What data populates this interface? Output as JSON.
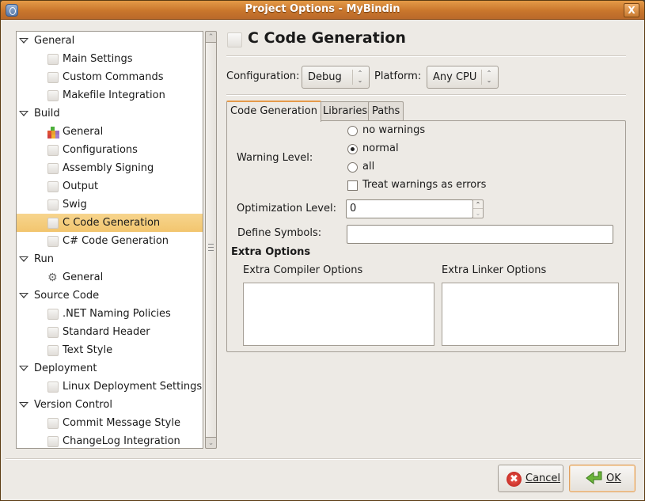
{
  "window": {
    "title": "Project Options - MyBindin",
    "close_label": "X"
  },
  "sidebar": {
    "categories": [
      {
        "label": "General",
        "expanded": true,
        "items": [
          {
            "label": "Main Settings",
            "icon": "blank-page-icon"
          },
          {
            "label": "Custom Commands",
            "icon": "blank-page-icon"
          },
          {
            "label": "Makefile Integration",
            "icon": "blank-page-icon"
          }
        ]
      },
      {
        "label": "Build",
        "expanded": true,
        "items": [
          {
            "label": "General",
            "icon": "build-blocks-icon"
          },
          {
            "label": "Configurations",
            "icon": "blank-page-icon"
          },
          {
            "label": "Assembly Signing",
            "icon": "blank-page-icon"
          },
          {
            "label": "Output",
            "icon": "blank-page-icon"
          },
          {
            "label": "Swig",
            "icon": "blank-page-icon"
          },
          {
            "label": "C Code Generation",
            "icon": "blank-page-icon",
            "selected": true
          },
          {
            "label": "C# Code Generation",
            "icon": "blank-page-icon"
          }
        ]
      },
      {
        "label": "Run",
        "expanded": true,
        "items": [
          {
            "label": "General",
            "icon": "gears-icon"
          }
        ]
      },
      {
        "label": "Source Code",
        "expanded": true,
        "items": [
          {
            "label": ".NET Naming Policies",
            "icon": "blank-page-icon"
          },
          {
            "label": "Standard Header",
            "icon": "blank-page-icon"
          },
          {
            "label": "Text Style",
            "icon": "blank-page-icon"
          }
        ]
      },
      {
        "label": "Deployment",
        "expanded": true,
        "items": [
          {
            "label": "Linux Deployment Settings",
            "icon": "blank-page-icon"
          }
        ]
      },
      {
        "label": "Version Control",
        "expanded": true,
        "items": [
          {
            "label": "Commit Message Style",
            "icon": "blank-page-icon"
          },
          {
            "label": "ChangeLog Integration",
            "icon": "blank-page-icon"
          }
        ]
      }
    ]
  },
  "panel": {
    "title": "C Code Generation",
    "configuration_label": "Configuration:",
    "configuration_value": "Debug",
    "platform_label": "Platform:",
    "platform_value": "Any CPU",
    "tabs": [
      {
        "label": "Code Generation",
        "active": true
      },
      {
        "label": "Libraries",
        "active": false
      },
      {
        "label": "Paths",
        "active": false
      }
    ],
    "warning_level_label": "Warning Level:",
    "warning_options": [
      {
        "label": "no warnings",
        "checked": false
      },
      {
        "label": "normal",
        "checked": true
      },
      {
        "label": "all",
        "checked": false
      }
    ],
    "treat_warnings_label": "Treat warnings as errors",
    "treat_warnings_checked": false,
    "optimization_label": "Optimization Level:",
    "optimization_value": "0",
    "define_symbols_label": "Define Symbols:",
    "define_symbols_value": "",
    "extra_options_heading": "Extra Options",
    "extra_compiler_label": "Extra Compiler Options",
    "extra_compiler_value": "",
    "extra_linker_label": "Extra Linker Options",
    "extra_linker_value": ""
  },
  "buttons": {
    "cancel_mnemonic": "C",
    "cancel_rest": "ancel",
    "ok_mnemonic": "O",
    "ok_rest": "K"
  },
  "colors": {
    "titlebar": "#c9762c",
    "selection": "#f2c56e",
    "tab_accent": "#e59a4a"
  }
}
